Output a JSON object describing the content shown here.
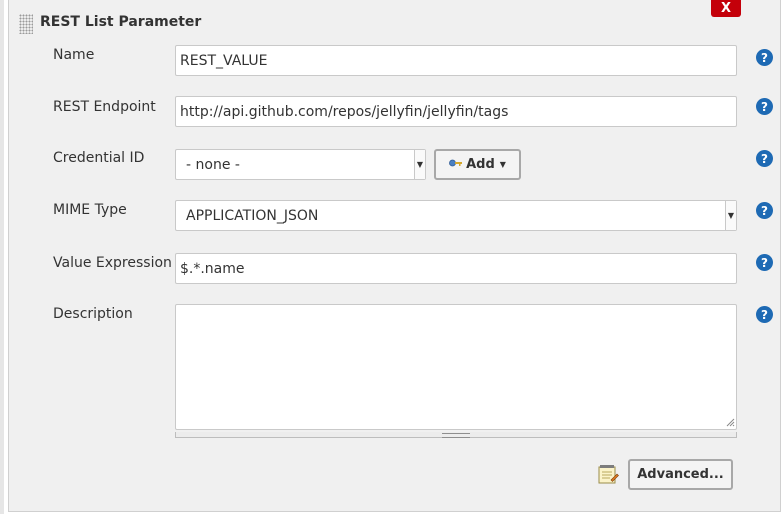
{
  "section": {
    "title": "REST List Parameter",
    "close_label": "X"
  },
  "fields": {
    "name": {
      "label": "Name",
      "value": "REST_VALUE"
    },
    "endpoint": {
      "label": "REST Endpoint",
      "value": "http://api.github.com/repos/jellyfin/jellyfin/tags"
    },
    "credential": {
      "label": "Credential ID",
      "selected": "- none -",
      "add_label": "Add"
    },
    "mime": {
      "label": "MIME Type",
      "selected": "APPLICATION_JSON"
    },
    "value_expression": {
      "label": "Value Expression",
      "value": "$.*.name"
    },
    "description": {
      "label": "Description",
      "value": ""
    }
  },
  "help_label": "?",
  "advanced_label": "Advanced...",
  "colors": {
    "close_button": "#c4000a",
    "help_icon": "#1e6ab4",
    "panel_background": "#f0f0f0"
  },
  "icons": [
    "drag-handle-icon",
    "close-icon",
    "key-icon",
    "caret-down-icon",
    "help-icon",
    "notepad-icon",
    "resize-grip-icon"
  ]
}
